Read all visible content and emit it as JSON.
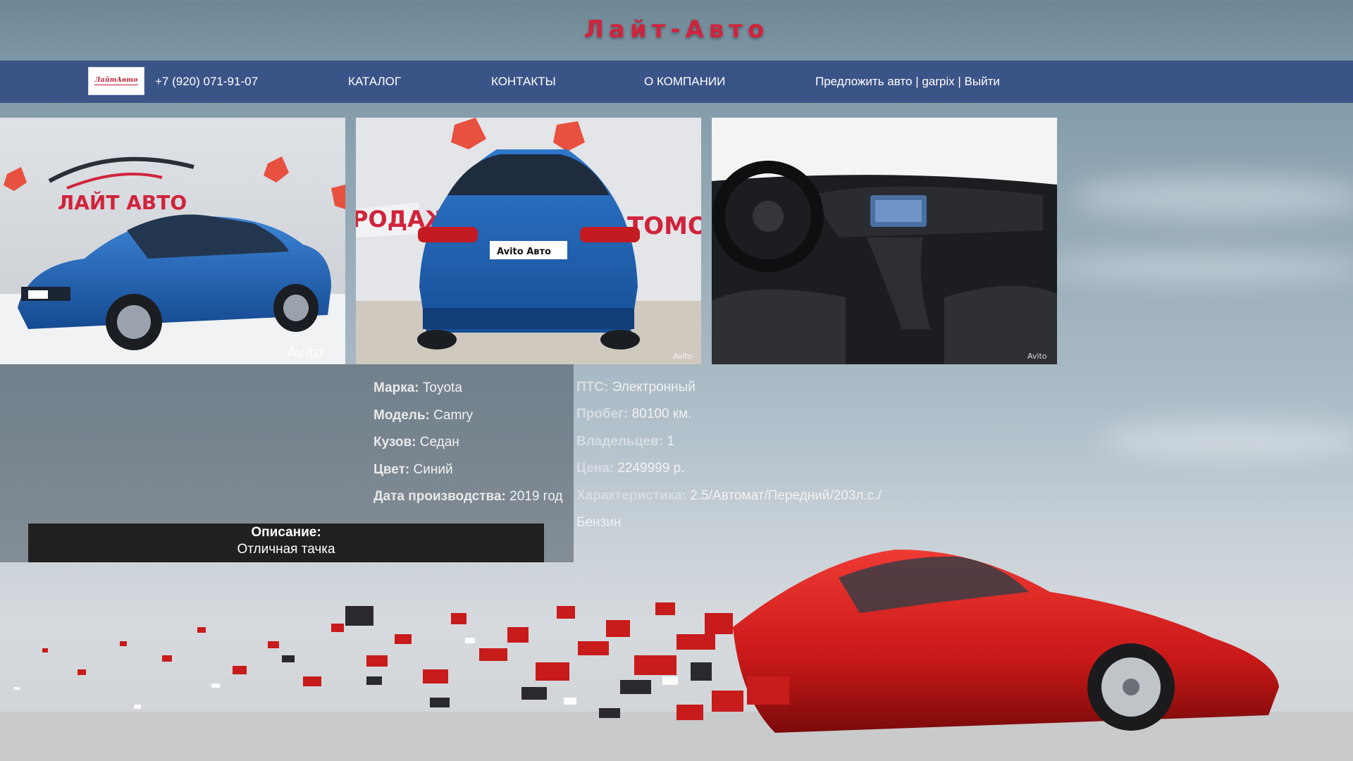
{
  "site": {
    "title": "Лайт-Авто"
  },
  "header": {
    "logo_text": "ЛайтАвто",
    "phone": "+7 (920) 071-91-07",
    "nav": [
      "КАТАЛОГ",
      "КОНТАКТЫ",
      "О КОМПАНИИ"
    ],
    "suggest_label": "Предложить авто",
    "username": "garpix",
    "logout_label": "Выйти",
    "separator": "|"
  },
  "gallery": {
    "photo1": {
      "banner_text": "ЛАЙТ АВТО",
      "watermark": "Avito"
    },
    "photo2": {
      "plate_text": "Avito Авто",
      "watermark": "Avito"
    },
    "photo3": {
      "watermark": "Avito"
    }
  },
  "car": {
    "brand_label": "Марка:",
    "brand": "Toyota",
    "model_label": "Модель:",
    "model": "Camry",
    "body_label": "Кузов:",
    "body": "Седан",
    "color_label": "Цвет:",
    "color": "Синий",
    "year_label": "Дата производства:",
    "year": "2019 год",
    "pts_label": "ПТС:",
    "pts": "Электронный",
    "mileage_label": "Пробег:",
    "mileage": "80100 км.",
    "owners_label": "Владельцев:",
    "owners": "1",
    "price_label": "Цена:",
    "price": "2249999 р.",
    "specs_label": "Характеристика:",
    "specs": "2.5/Автомат/Передний/203л.с./",
    "fuel": "Бензин"
  },
  "description": {
    "title": "Описание:",
    "text": "Отличная тачка"
  },
  "colors": {
    "accent": "#d0243c",
    "nav_bg": "#3b5488",
    "car_blue": "#1f5fb0",
    "hero_red": "#d81e1e"
  }
}
